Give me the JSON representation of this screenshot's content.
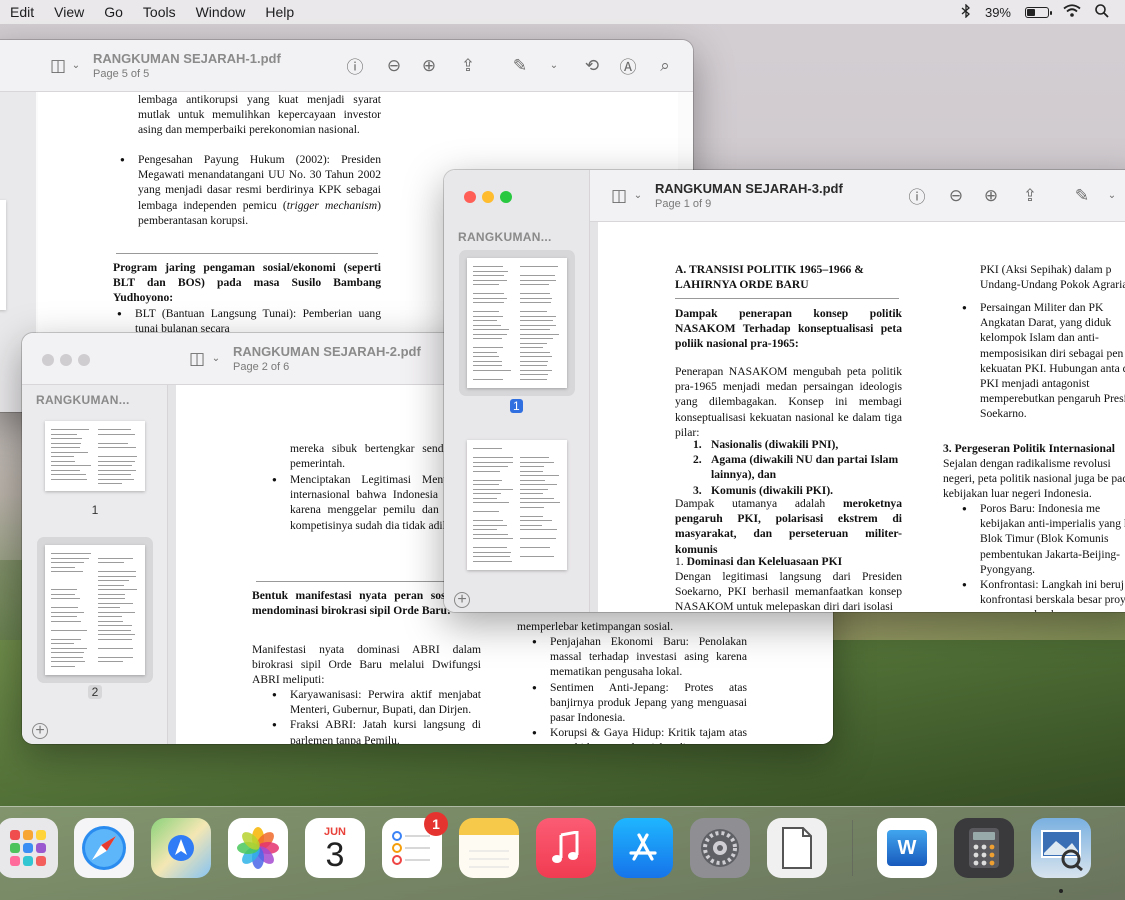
{
  "menubar": {
    "items": [
      "Edit",
      "View",
      "Go",
      "Tools",
      "Window",
      "Help"
    ],
    "battery_percent": "39%",
    "battery_level": 0.39
  },
  "win1": {
    "title": "RANGKUMAN SEJARAH-1.pdf",
    "subtitle": "Page 5 of 5",
    "text_a": "lembaga antikorupsi yang kuat menjadi syarat mutlak untuk memulihkan kepercayaan investor asing dan memperbaiki perekonomian nasional.",
    "bullet1_a": "Pengesahan Payung Hukum (2002): Presiden Megawati menandatangani UU No. 30 Tahun 2002 yang menjadi dasar resmi berdirinya KPK sebagai lembaga independen pemicu (",
    "bullet1_em": "trigger mechanism",
    "bullet1_b": ") pemberantasan korupsi.",
    "heading": "Program jaring pengaman sosial/ekonomi (seperti BLT dan BOS) pada masa Susilo Bambang Yudhoyono:",
    "bullet2": "BLT (Bantuan Langsung Tunai): Pemberian uang tunai bulanan secara"
  },
  "win2": {
    "title": "RANGKUMAN SEJARAH-2.pdf",
    "subtitle": "Page 2 of 6",
    "sidebar_title": "RANGKUMAN...",
    "page_labels": [
      "1",
      "2"
    ],
    "col1_top": "mereka sibuk bertengkar send lupa mengkritik pemerintah.",
    "col1_bullet": "Menciptakan Legitimasi Menunjukkan kepada internasional bahwa Indonesia negara demokrasi karena menggelar pemilu dan memiliki padahal kompetisinya sudah dia tidak adil.",
    "col1_heading": "Bentuk manifestasi nyata peran sosial ABRI dalam mendominasi birokrasi sipil Orde Baru:",
    "col1_para": "Manifestasi nyata dominasi ABRI dalam birokrasi sipil Orde Baru melalui Dwifungsi ABRI meliputi:",
    "col1_b1": "Karyawanisasi: Perwira aktif menjabat Menteri, Gubernur, Bupati, dan Dirjen.",
    "col1_b2": "Fraksi ABRI: Jatah kursi langsung di parlemen tanpa Pemilu.",
    "col2_top": "memperlebar ketimpangan sosial.",
    "col2_b1": "Penjajahan Ekonomi Baru: Penolakan massal terhadap investasi asing karena mematikan pengusaha lokal.",
    "col2_b2": "Sentimen Anti-Jepang: Protes atas banjirnya produk Jepang yang menguasai pasar Indonesia.",
    "col2_b3": "Korupsi & Gaya Hidup: Kritik tajam atas gaya hidup mewah pejabat di"
  },
  "win3": {
    "title": "RANGKUMAN SEJARAH-3.pdf",
    "subtitle": "Page 1 of 9",
    "sidebar_title": "RANGKUMAN...",
    "page_labels": [
      "1"
    ],
    "heading": "A. TRANSISI POLITIK 1965–1966 & LAHIRNYA ORDE BARU",
    "q1": "Dampak penerapan konsep politik NASAKOM Terhadap konseptualisasi peta poliik nasional pra-1965:",
    "p1": "Penerapan NASAKOM mengubah peta politik pra-1965 menjadi medan persaingan ideologis yang dilembagakan. Konsep ini membagi konseptualisasi kekuatan nasional ke dalam tiga pilar:",
    "list": [
      "Nasionalis (diwakili PNI),",
      "Agama (diwakili NU dan partai Islam lainnya), dan",
      "Komunis (diwakili PKI)."
    ],
    "list_nums": [
      "1.",
      "2.",
      "3."
    ],
    "p2_a": "Dampak utamanya adalah ",
    "p2_b": "meroketnya pengaruh PKI, polarisasi ekstrem di masyarakat, dan perseteruan militer-komunis",
    "sub1_num": "1. ",
    "sub1": "Dominasi dan Keleluasaan PKI",
    "p3": "Dengan legitimasi langsung dari Presiden Soekarno, PKI berhasil memanfaatkan konsep NASAKOM untuk melepaskan diri dari isolasi",
    "col2_top": "PKI (Aksi Sepihak) dalam p Undang-Undang Pokok Agraria",
    "col2_b1": "Persaingan Militer dan PK Angkatan Darat, yang diduk kelompok Islam dan anti- memposisikan diri sebagai pen kekuatan PKI. Hubungan anta dan PKI menjadi antagonist memperebutkan pengaruh Presiden Soekarno.",
    "col2_heading": "3. Pergeseran Politik Internasional",
    "col2_para": "Sejalan dengan radikalisme revolusi negeri, peta politik nasional juga be pada kebijakan luar negeri Indonesia.",
    "col2_b2": "Poros Baru: Indonesia me kebijakan anti-imperialis yang ke Blok Timur (Blok Komunis pembentukan Jakarta-Beijing-Pyongyang.",
    "col2_b3": "Konfrontasi: Langkah ini beruj konfrontasi berskala besar proyek mercusuar dan k"
  },
  "dock": {
    "calendar_month": "JUN",
    "calendar_day": "3",
    "reminders_badge": "1",
    "word_label": "W",
    "icons": [
      "launchpad-icon",
      "safari-icon",
      "maps-icon",
      "photos-icon",
      "calendar-icon",
      "reminders-icon",
      "notes-icon",
      "music-icon",
      "app-store-icon",
      "system-preferences-icon",
      "textedit-icon",
      "word-icon",
      "calculator-icon",
      "preview-icon"
    ]
  },
  "colors": {
    "accent": "#2f6fe0",
    "close": "#ff5f57",
    "minimize": "#febc2e",
    "zoom": "#28c840"
  }
}
